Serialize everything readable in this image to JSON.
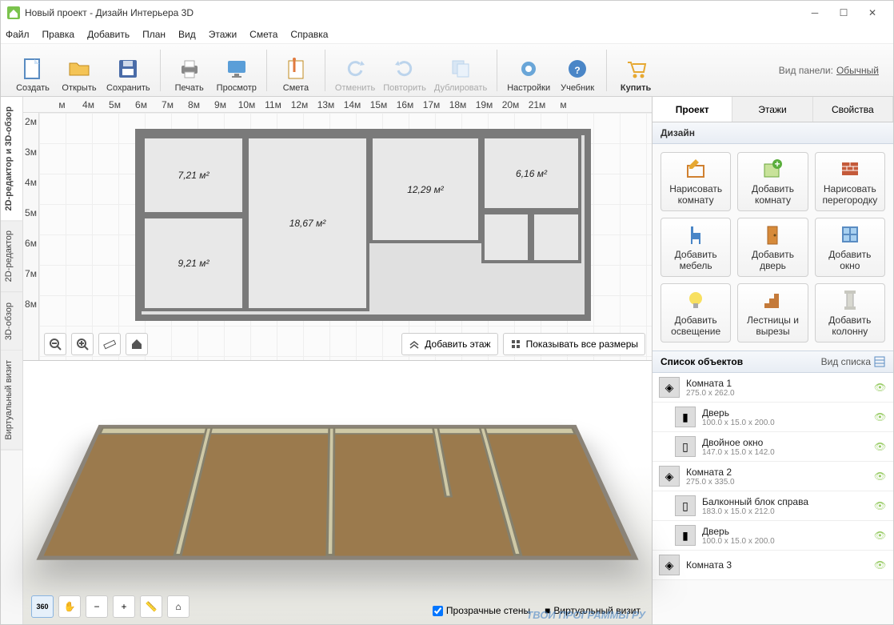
{
  "window": {
    "title": "Новый проект - Дизайн Интерьера 3D"
  },
  "menu": [
    "Файл",
    "Правка",
    "Добавить",
    "План",
    "Вид",
    "Этажи",
    "Смета",
    "Справка"
  ],
  "toolbar": {
    "create": "Создать",
    "open": "Открыть",
    "save": "Сохранить",
    "print": "Печать",
    "preview": "Просмотр",
    "estimate": "Смета",
    "undo": "Отменить",
    "redo": "Повторить",
    "duplicate": "Дублировать",
    "settings": "Настройки",
    "tutorial": "Учебник",
    "buy": "Купить",
    "panel_mode_label": "Вид панели:",
    "panel_mode_value": "Обычный"
  },
  "side_tabs": {
    "t1": "2D-редактор и 3D-обзор",
    "t2": "2D-редактор",
    "t3": "3D-обзор",
    "t4": "Виртуальный визит"
  },
  "ruler_h": [
    "м",
    "4м",
    "5м",
    "6м",
    "7м",
    "8м",
    "9м",
    "10м",
    "11м",
    "12м",
    "13м",
    "14м",
    "15м",
    "16м",
    "17м",
    "18м",
    "19м",
    "20м",
    "21м",
    "м"
  ],
  "ruler_v": [
    "2м",
    "3м",
    "4м",
    "5м",
    "6м",
    "7м",
    "8м"
  ],
  "rooms": {
    "r1": "7,21 м²",
    "r2": "18,67 м²",
    "r3": "12,29 м²",
    "r4": "6,16 м²",
    "r5": "9,21 м²"
  },
  "plan_actions": {
    "add_floor": "Добавить этаж",
    "show_dims": "Показывать все размеры"
  },
  "view3d": {
    "transparent": "Прозрачные стены",
    "walk": "Виртуальный визит"
  },
  "rp_tabs": {
    "project": "Проект",
    "floors": "Этажи",
    "props": "Свойства"
  },
  "rp_section": "Дизайн",
  "design_btns": {
    "b1a": "Нарисовать",
    "b1b": "комнату",
    "b2a": "Добавить",
    "b2b": "комнату",
    "b3a": "Нарисовать",
    "b3b": "перегородку",
    "b4a": "Добавить",
    "b4b": "мебель",
    "b5a": "Добавить",
    "b5b": "дверь",
    "b6a": "Добавить",
    "b6b": "окно",
    "b7a": "Добавить",
    "b7b": "освещение",
    "b8a": "Лестницы и",
    "b8b": "вырезы",
    "b9a": "Добавить",
    "b9b": "колонну"
  },
  "obj_header": "Список объектов",
  "obj_view_mode": "Вид списка",
  "objects": [
    {
      "name": "Комната 1",
      "dims": "275.0 x 262.0",
      "type": "room"
    },
    {
      "name": "Дверь",
      "dims": "100.0 x 15.0 x 200.0",
      "type": "door",
      "child": true
    },
    {
      "name": "Двойное окно",
      "dims": "147.0 x 15.0 x 142.0",
      "type": "window",
      "child": true
    },
    {
      "name": "Комната 2",
      "dims": "275.0 x 335.0",
      "type": "room"
    },
    {
      "name": "Балконный блок справа",
      "dims": "183.0 x 15.0 x 212.0",
      "type": "window",
      "child": true
    },
    {
      "name": "Дверь",
      "dims": "100.0 x 15.0 x 200.0",
      "type": "door",
      "child": true
    },
    {
      "name": "Комната 3",
      "dims": "",
      "type": "room"
    }
  ],
  "watermark": "ТВОИ ПРОГРАММЫ РУ"
}
